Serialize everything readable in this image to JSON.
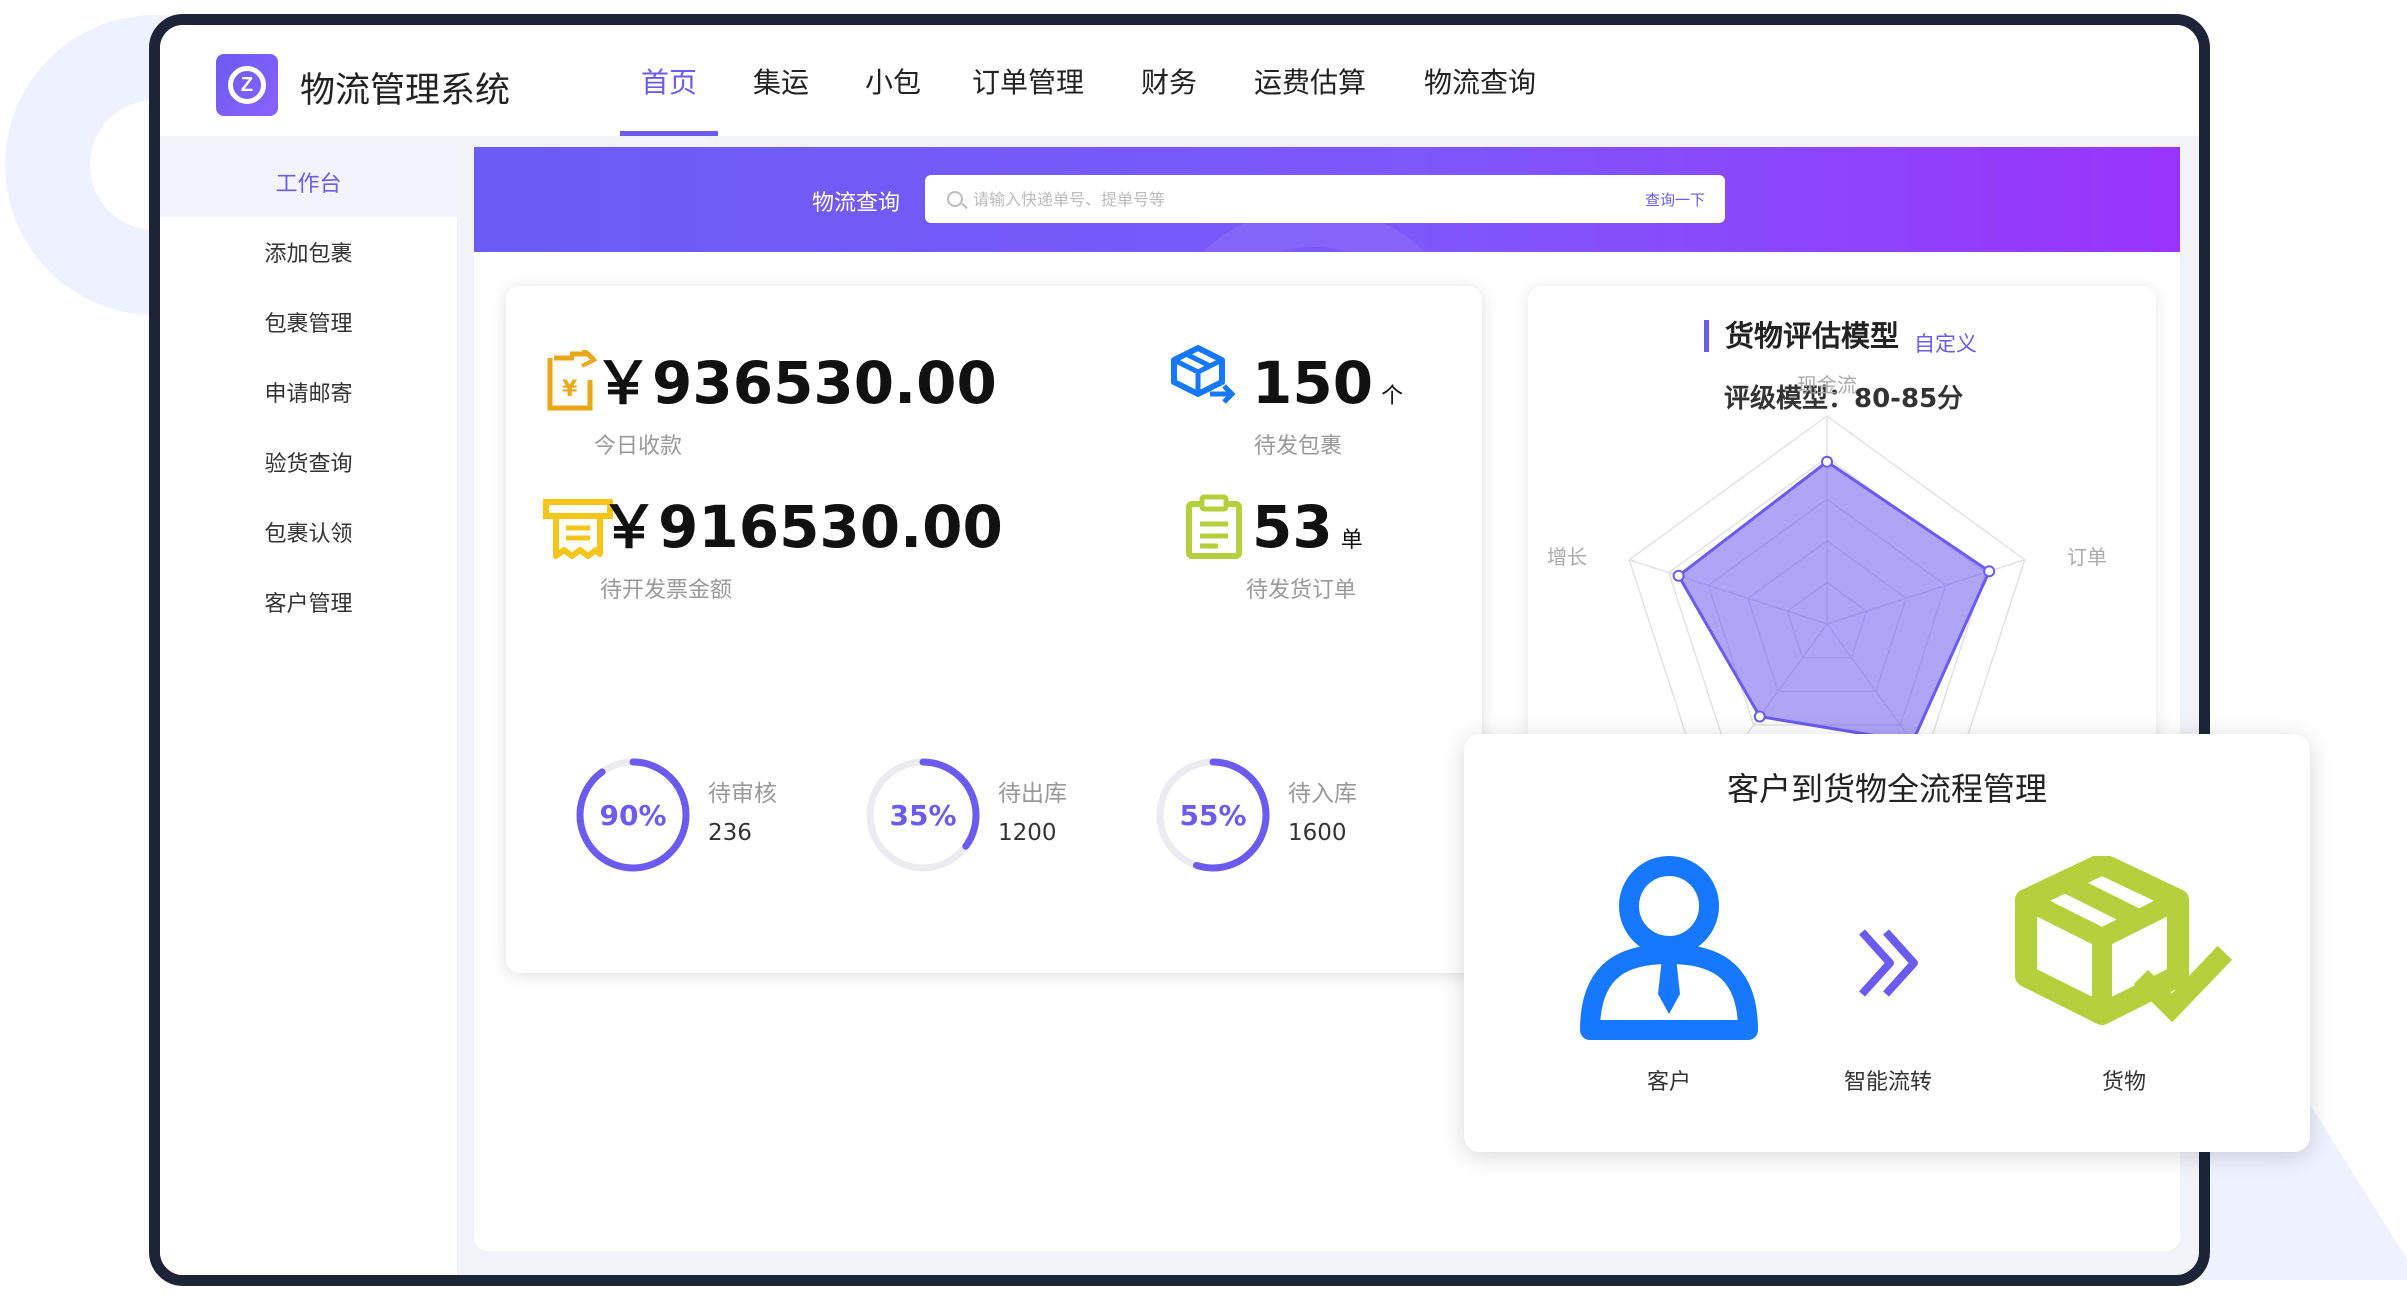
{
  "app": {
    "title": "物流管理系统"
  },
  "nav": [
    {
      "label": "首页",
      "active": true
    },
    {
      "label": "集运"
    },
    {
      "label": "小包"
    },
    {
      "label": "订单管理"
    },
    {
      "label": "财务"
    },
    {
      "label": "运费估算"
    },
    {
      "label": "物流查询"
    }
  ],
  "sidebar": {
    "items": [
      {
        "label": "工作台",
        "active": true
      },
      {
        "label": "添加包裹"
      },
      {
        "label": "包裹管理"
      },
      {
        "label": "申请邮寄"
      },
      {
        "label": "验货查询"
      },
      {
        "label": "包裹认领"
      },
      {
        "label": "客户管理"
      }
    ]
  },
  "search": {
    "label": "物流查询",
    "placeholder": "请输入快递单号、提单号等",
    "button": "查询一下"
  },
  "stats": {
    "today_income": {
      "value": "￥936530.00",
      "label": "今日收款"
    },
    "pending_parcels": {
      "value": "150",
      "unit": "个",
      "label": "待发包裹"
    },
    "pending_invoice": {
      "value": "￥916530.00",
      "label": "待开发票金额"
    },
    "pending_orders": {
      "value": "53",
      "unit": "单",
      "label": "待发货订单"
    }
  },
  "progress": [
    {
      "percent_text": "90%",
      "percent": 90,
      "label": "待审核",
      "count": "236"
    },
    {
      "percent_text": "35%",
      "percent": 35,
      "label": "待出库",
      "count": "1200"
    },
    {
      "percent_text": "55%",
      "percent": 55,
      "label": "待入库",
      "count": "1600"
    }
  ],
  "radar": {
    "title": "货物评估模型",
    "custom_link": "自定义",
    "model_text": "评级模型：80-85分",
    "axes": [
      "现金流",
      "订单",
      "",
      "",
      "增长"
    ],
    "values": [
      0.78,
      0.82,
      0.7,
      0.55,
      0.75
    ]
  },
  "flow": {
    "title": "客户到货物全流程管理",
    "steps": [
      {
        "label": "客户"
      },
      {
        "label": "智能流转"
      },
      {
        "label": "货物"
      }
    ]
  },
  "colors": {
    "accent": "#6b5bf0",
    "gradient_start": "#6a5cf4",
    "gradient_end": "#9a34fb",
    "gold": "#e9a81a",
    "yellow": "#f5c518",
    "blue": "#1677ff",
    "lime": "#b6cf3c"
  }
}
